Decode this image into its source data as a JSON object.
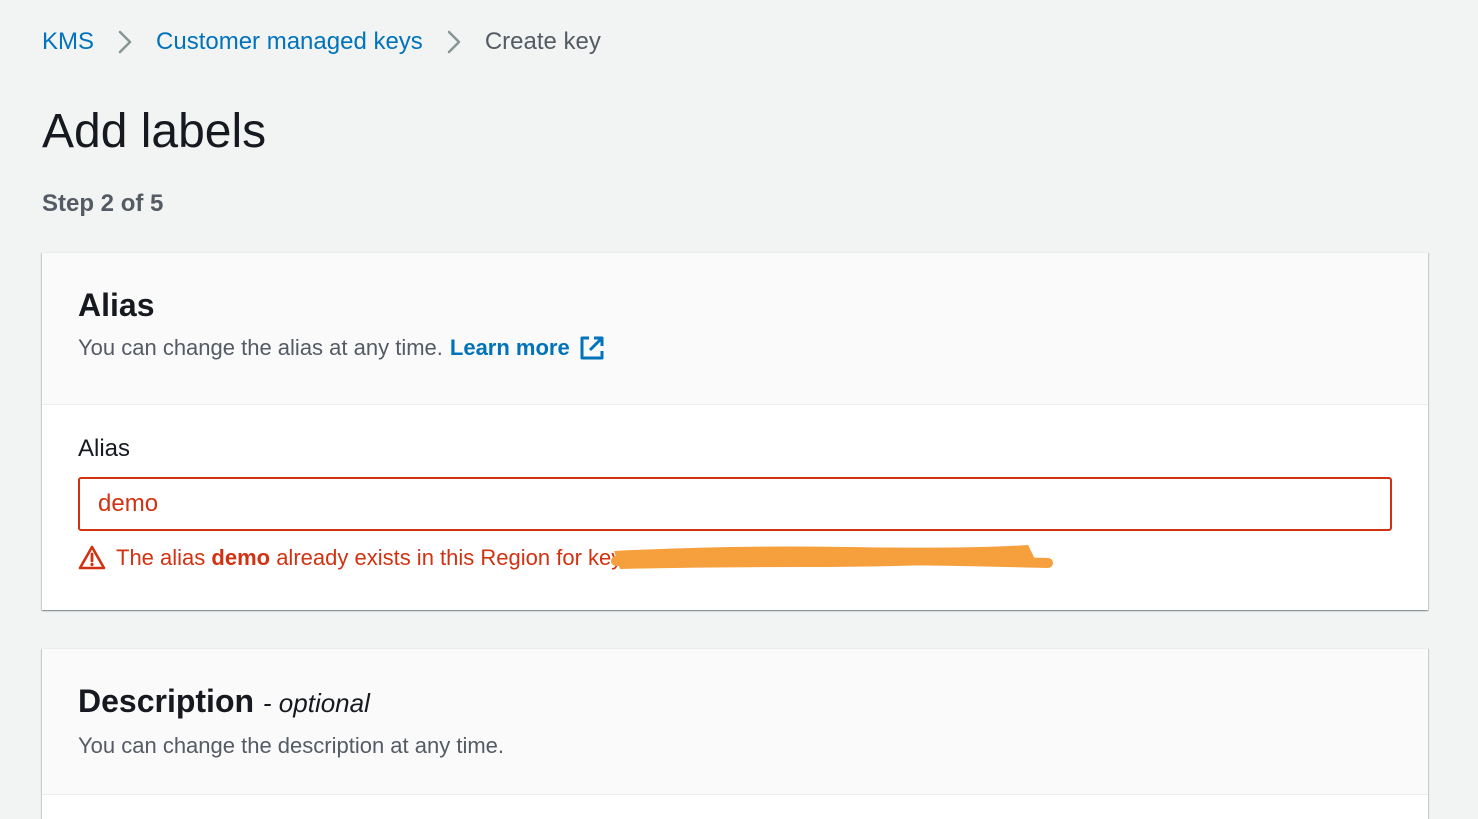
{
  "breadcrumb": {
    "items": [
      {
        "label": "KMS"
      },
      {
        "label": "Customer managed keys"
      },
      {
        "label": "Create key"
      }
    ]
  },
  "page": {
    "title": "Add labels",
    "step": "Step 2 of 5"
  },
  "alias_panel": {
    "title": "Alias",
    "description": "You can change the alias at any time.",
    "learn_more": "Learn more",
    "field_label": "Alias",
    "input_value": "demo",
    "error_prefix": "The alias ",
    "error_alias": "demo",
    "error_suffix": " already exists in this Region for key"
  },
  "description_panel": {
    "title": "Description",
    "optional_label": "- optional",
    "description": "You can change the description at any time."
  },
  "colors": {
    "link": "#0073bb",
    "error": "#d13212",
    "redaction": "#f5a03c",
    "background": "#f2f3f3"
  }
}
